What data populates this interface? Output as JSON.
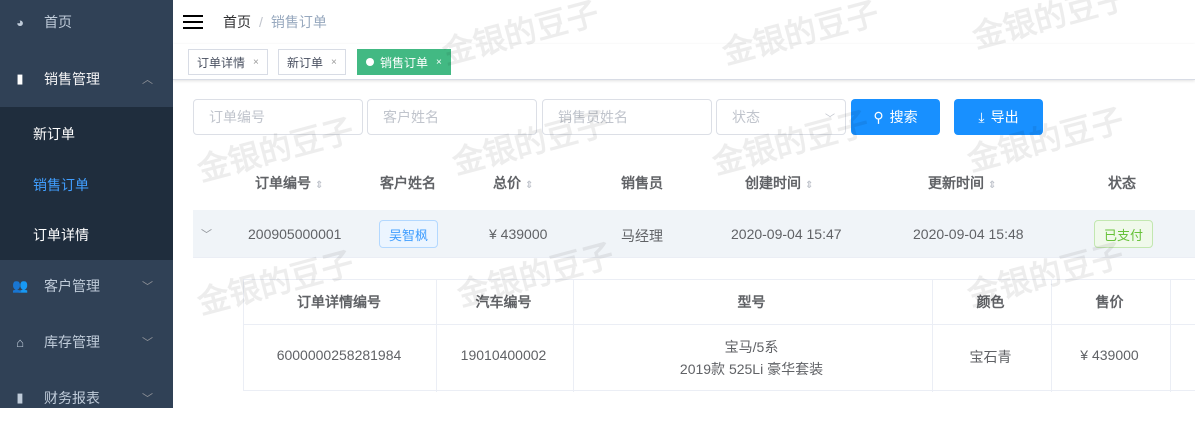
{
  "sidebar": {
    "items": [
      {
        "label": "首页",
        "icon": "dashboard-icon"
      },
      {
        "label": "销售管理",
        "icon": "document-icon",
        "expanded": true,
        "children": [
          {
            "label": "新订单"
          },
          {
            "label": "销售订单",
            "active": true
          },
          {
            "label": "订单详情"
          }
        ]
      },
      {
        "label": "客户管理",
        "icon": "people-icon"
      },
      {
        "label": "库存管理",
        "icon": "warehouse-icon"
      },
      {
        "label": "财务报表",
        "icon": "chart-icon"
      }
    ]
  },
  "breadcrumb": {
    "home": "首页",
    "sep": "/",
    "current": "销售订单"
  },
  "tags": [
    {
      "label": "订单详情"
    },
    {
      "label": "新订单"
    },
    {
      "label": "销售订单",
      "active": true
    }
  ],
  "filters": {
    "order_no": "订单编号",
    "customer": "客户姓名",
    "salesman": "销售员姓名",
    "status": "状态",
    "search": "搜索",
    "export": "导出"
  },
  "table": {
    "headers": [
      "订单编号",
      "客户姓名",
      "总价",
      "销售员",
      "创建时间",
      "更新时间",
      "状态"
    ],
    "rows": [
      {
        "order_no": "200905000001",
        "customer": "吴智枫",
        "total": "¥ 439000",
        "salesman": "马经理",
        "created": "2020-09-04 15:47",
        "updated": "2020-09-04 15:48",
        "status": "已支付"
      }
    ]
  },
  "detail": {
    "headers": [
      "订单详情编号",
      "汽车编号",
      "型号",
      "颜色",
      "售价"
    ],
    "rows": [
      {
        "detail_no": "6000000258281984",
        "car_no": "19010400002",
        "model_line1": "宝马/5系",
        "model_line2": "2019款 525Li 豪华套装",
        "color": "宝石青",
        "price": "¥ 439000"
      }
    ]
  },
  "watermark": "金银的豆子",
  "colors": {
    "sidebar": "#304156",
    "accent": "#409eff",
    "tag_active": "#42b983",
    "button": "#1890ff"
  }
}
